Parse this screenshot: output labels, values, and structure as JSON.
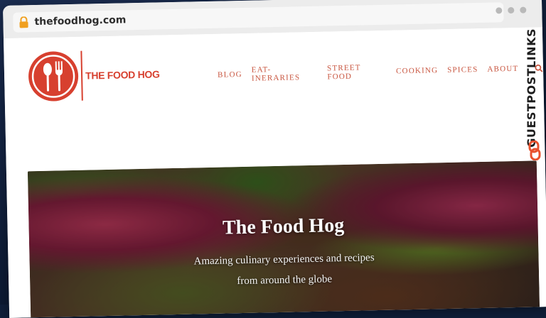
{
  "browser": {
    "url": "thefoodhog.com"
  },
  "site": {
    "logo_text": "THE FOOD HOG",
    "brand_color": "#d7402f",
    "nav": [
      "BLOG",
      "EAT-INERARIES",
      "STREET FOOD",
      "COOKING",
      "SPICES",
      "ABOUT"
    ],
    "search_icon": "search-icon"
  },
  "hero": {
    "title": "The Food Hog",
    "subtitle_line1": "Amazing culinary experiences and recipes",
    "subtitle_line2": "from around the globe"
  },
  "watermark": {
    "text": "GUESTPOSTLINKS",
    "accent_color": "#e8522e"
  }
}
